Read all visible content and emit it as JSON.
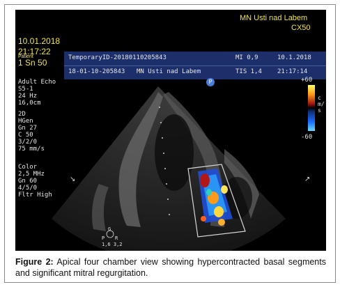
{
  "overlay": {
    "site_top_right": "MN Usti nad Labem",
    "device": "CX50",
    "date": "10.01.2018",
    "time": "21:17:22",
    "patient_label": "Patient",
    "sn_label": "1 Sn 50",
    "temp_id": "TemporaryID-20180110205843",
    "exam_id": "18-01-10-205843",
    "site": "MN Usti nad Labem",
    "mi": "MI 0,9",
    "tis": "TIS 1,4",
    "date2": "10.1.2018",
    "time2": "21:17:14",
    "p_marker": "P"
  },
  "left_panel": {
    "preset": "Adult Echo",
    "probe": "S5-1",
    "fps": "24 Hz",
    "depth": "16,0cm",
    "mode_2d": "2D",
    "hgen": "HGen",
    "gn_2d": "Gn 27",
    "c": "C 50",
    "values_2d": "3/2/0",
    "speed": "75 mm/s",
    "color_label": "Color",
    "freq": "2,5 MHz",
    "gn_color": "Gn 60",
    "values_color": "4/5/0",
    "filter": "Fltr High"
  },
  "color_scale": {
    "top": "+60",
    "bottom": "-60",
    "unit": "cm/s"
  },
  "bottom_marker": {
    "g": "G",
    "p": "P",
    "r": "R",
    "values": "1,6 3,2"
  },
  "caption": {
    "label": "Figure 2:",
    "text": " Apical four chamber view showing hypercontracted basal segments and significant mitral regurgitation."
  },
  "colors": {
    "overlay_blue": "#1c2f6b",
    "overlay_yellow": "#f2e44a"
  }
}
